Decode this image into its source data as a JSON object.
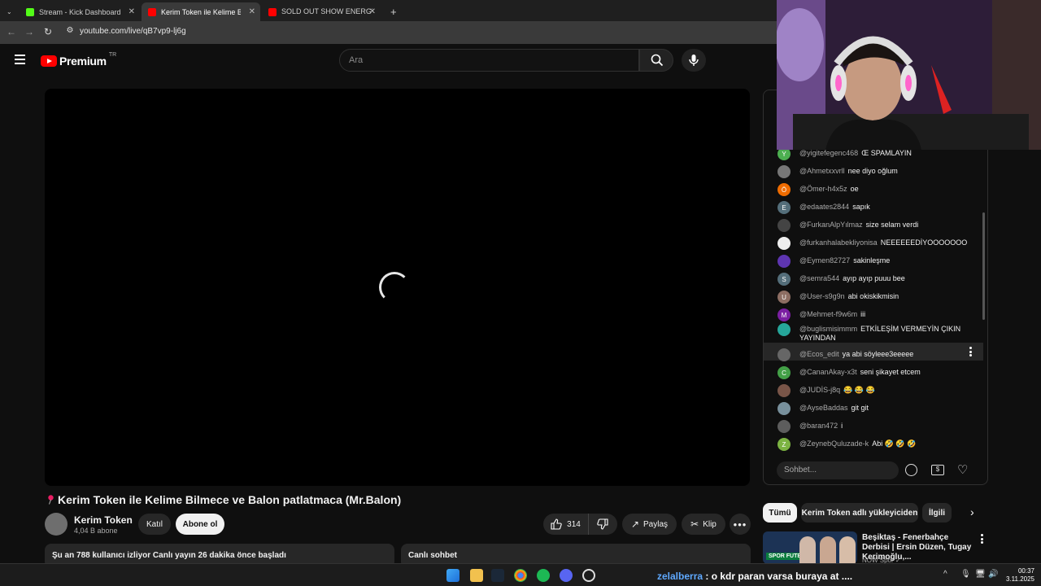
{
  "browser": {
    "tabs": [
      {
        "label": "Stream - Kick Dashboard",
        "icon": "kick-icon",
        "color": "#53fc18",
        "active": false
      },
      {
        "label": "Kerim Token ile Kelime Bilme",
        "icon": "youtube-icon",
        "color": "#ff0000",
        "active": true
      },
      {
        "label": "SOLD OUT SHOW ENERGY 🎤 🌞",
        "icon": "youtube-icon",
        "color": "#ff0000",
        "active": false
      }
    ],
    "new_tab": "+",
    "url": "youtube.com/live/qB7vp9-lj6g"
  },
  "yt_header": {
    "logo_text": "Premium",
    "region": "TR",
    "search_placeholder": "Ara"
  },
  "video": {
    "title": "Kerim Token ile Kelime Bilmece ve Balon patlatmaca (Mr.Balon)",
    "channel": "Kerim Token",
    "subscribers": "4,04 B abone",
    "join_label": "Katıl",
    "subscribe_label": "Abone ol",
    "likes": "314",
    "share_label": "Paylaş",
    "clip_label": "Klip",
    "watching_text": "Şu an 788 kullanıcı izliyor  Canlı yayın 26 dakika önce başladı",
    "live_chat_label": "Canlı sohbet"
  },
  "chat": {
    "messages": [
      {
        "user": "@yigitefegenc468",
        "text": "Œ SPAMLAYIN",
        "avatar": "Y",
        "color": "#4caf50"
      },
      {
        "user": "@Ahmetxxvrll",
        "text": "nee diyo oğlum",
        "avatar": "",
        "color": "#777777"
      },
      {
        "user": "@Ömer-h4x5z",
        "text": "oe",
        "avatar": "Ö",
        "color": "#ef6c00"
      },
      {
        "user": "@edaates2844",
        "text": "sapık",
        "avatar": "E",
        "color": "#546e7a"
      },
      {
        "user": "@FurkanAlpYılmaz",
        "text": "size selam verdi",
        "avatar": "",
        "color": "#444444"
      },
      {
        "user": "@furkanhalabekliyonisa",
        "text": "NEEEEEEDİYOOOOOOO",
        "avatar": "",
        "color": "#eeeeee"
      },
      {
        "user": "@Eymen82727",
        "text": "sakinleşme",
        "avatar": "",
        "color": "#5e35b1"
      },
      {
        "user": "@semra544",
        "text": "ayıp ayıp puuu bee",
        "avatar": "S",
        "color": "#546e7a"
      },
      {
        "user": "@User-s9g9n",
        "text": "abi okiskikmisin",
        "avatar": "U",
        "color": "#8d6e63"
      },
      {
        "user": "@Mehmet-f9w6m",
        "text": "iii",
        "avatar": "M",
        "color": "#7b1fa2"
      },
      {
        "user": "@buglismisimmm",
        "text": "ETKİLEŞİM VERMEYİN ÇIKIN YAYINDAN",
        "avatar": "",
        "color": "#26a69a"
      },
      {
        "user": "@Ecos_edit",
        "text": "ya abi söyleee3eeeee",
        "avatar": "",
        "color": "#666666"
      },
      {
        "user": "@CananAkay-x3t",
        "text": "seni şikayet etcem",
        "avatar": "C",
        "color": "#43a047"
      },
      {
        "user": "@JUDİS-j8q",
        "text": "😂 😂 😂",
        "avatar": "",
        "color": "#795548"
      },
      {
        "user": "@AyseBaddas",
        "text": "git git",
        "avatar": "",
        "color": "#78909c"
      },
      {
        "user": "@baran472",
        "text": "i",
        "avatar": "",
        "color": "#5d5d5d"
      },
      {
        "user": "@ZeynebQuluzade-k",
        "text": "Abi 🤣 🤣 🤣",
        "avatar": "Z",
        "color": "#7cb342"
      }
    ],
    "input_placeholder": "Sohbet..."
  },
  "recommendations": {
    "chips": [
      "Tümü",
      "Kerim Token adlı yükleyiciden",
      "İlgili"
    ],
    "first": {
      "title": "Beşiktaş - Fenerbahçe Derbisi | Ersin Düzen, Tugay Kerimoğlu,...",
      "channel": "NOW Spor ✓",
      "thumb_text": "SPOR FUTBOL"
    }
  },
  "taskbar": {
    "marquee_user": "zelalberra",
    "marquee_text": ": o kdr paran varsa buraya at ....",
    "time": "00:37",
    "date": "3.11.2025"
  }
}
